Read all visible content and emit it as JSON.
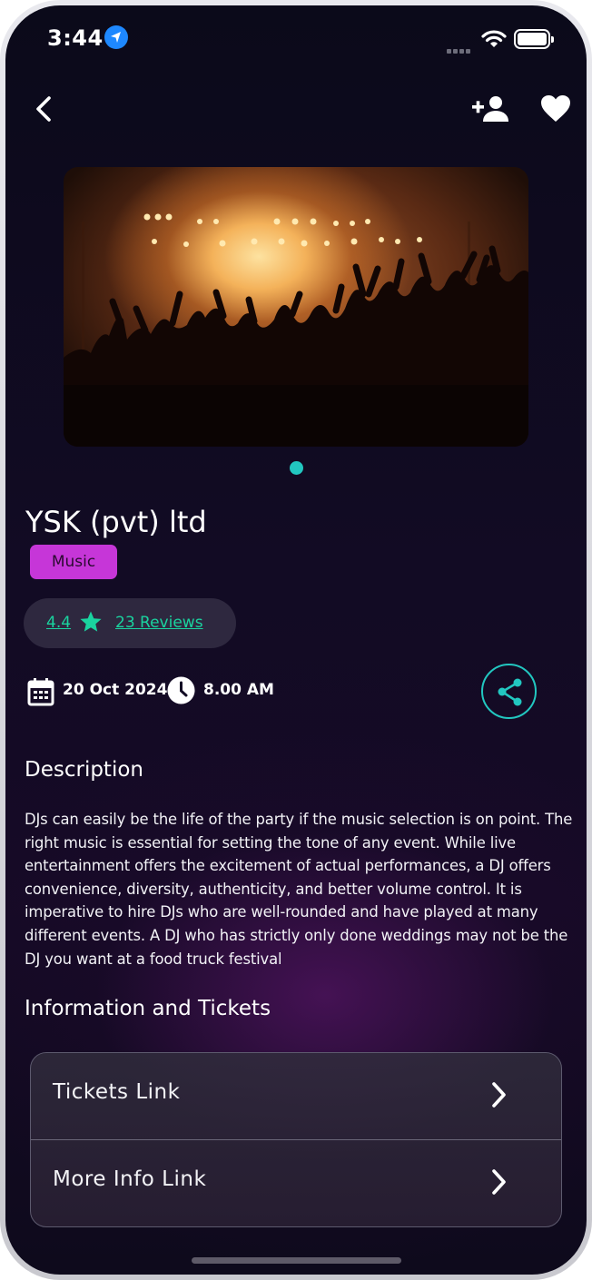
{
  "status_bar": {
    "time": "3:44",
    "location_icon": "location-arrow-icon",
    "signal_icon": "cellular-signal-icon",
    "wifi_icon": "wifi-icon",
    "battery_icon": "battery-icon"
  },
  "nav": {
    "back_icon": "chevron-left-icon",
    "add_user_icon": "person-add-icon",
    "favorite_icon": "heart-icon"
  },
  "hero": {
    "image": "concert-crowd-photo",
    "carousel_index": 1,
    "carousel_total": 1
  },
  "event": {
    "title": "YSK (pvt) ltd",
    "category": "Music",
    "rating": "4.4",
    "reviews": "23 Reviews",
    "date": "20 Oct 2024",
    "time": "8.00 AM"
  },
  "description": {
    "heading": "Description",
    "text": "DJs can easily be the life of the party if the music selection is on point. The right music is essential for setting the tone of any event. While live entertainment offers the excitement of actual performances, a DJ offers convenience, diversity, authenticity, and better volume control. It is imperative to hire DJs who are well-rounded and have played at many different events. A DJ who has strictly only done weddings may not be the DJ you want at a food truck festival"
  },
  "info": {
    "heading": "Information and Tickets",
    "links": [
      {
        "label": "Tickets Link"
      },
      {
        "label": "More Info Link"
      }
    ]
  },
  "colors": {
    "accent_teal": "#22c7c0",
    "rating_green": "#1ad39f",
    "badge_magenta": "#c636d8",
    "background": "#0e0a1c"
  }
}
